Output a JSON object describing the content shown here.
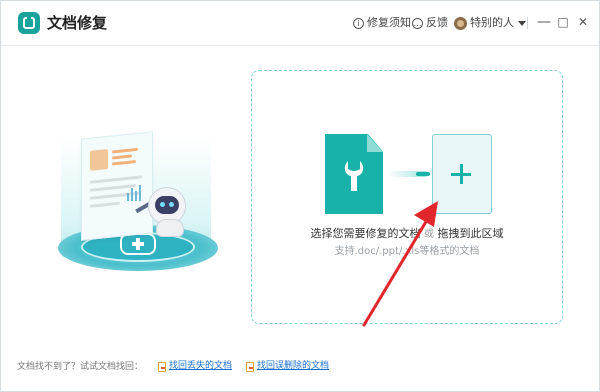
{
  "app": {
    "title": "文档修复"
  },
  "titlebar": {
    "help_label": "修复须知",
    "feedback_label": "反馈",
    "user_name": "特别的人",
    "minimize_glyph": "—",
    "maximize_glyph": "□",
    "close_glyph": "✕"
  },
  "dropzone": {
    "main_prefix": "选择您需要修复的文档",
    "main_or": "或",
    "main_suffix": "拖拽到此区域",
    "sub_text": "支持.doc/.ppt/.xls等格式的文档"
  },
  "footer": {
    "prompt": "文档找不到了？试试文档找回：",
    "link_lost": "找回丢失的文档",
    "link_deleted": "找回误删除的文档"
  },
  "colors": {
    "accent": "#19b2aa",
    "arrow": "#e0262a",
    "link": "#1a6fd0"
  }
}
